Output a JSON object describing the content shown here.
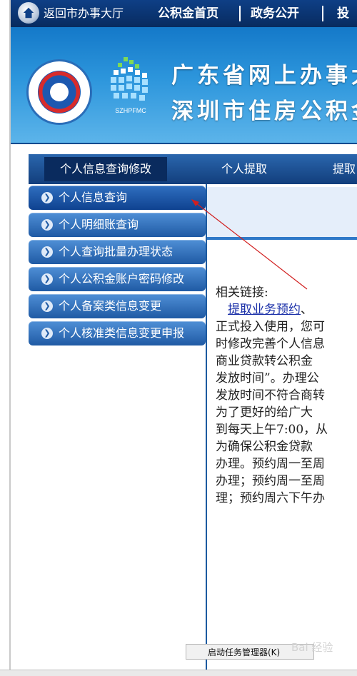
{
  "topnav": {
    "back_label": "返回市办事大厅",
    "items": [
      "公积金首页",
      "政务公开",
      "投"
    ]
  },
  "banner": {
    "line1": "广东省网上办事大",
    "line2": "深圳市住房公积金",
    "emblem_text": "SZHPFMC"
  },
  "tabs": [
    {
      "label": "个人信息查询修改",
      "active": true
    },
    {
      "label": "个人提取",
      "active": false
    },
    {
      "label": "提取",
      "active": false
    }
  ],
  "sidebar": {
    "items": [
      {
        "label": "个人信息查询",
        "icon": "arrow-right-icon"
      },
      {
        "label": "个人明细账查询",
        "icon": "arrow-right-icon"
      },
      {
        "label": "个人查询批量办理状态",
        "icon": "arrow-right-icon"
      },
      {
        "label": "个人公积金账户密码修改",
        "icon": "arrow-right-icon"
      },
      {
        "label": "个人备案类信息变更",
        "icon": "arrow-right-icon"
      },
      {
        "label": "个人核准类信息变更申报",
        "icon": "arrow-right-icon"
      }
    ]
  },
  "content": {
    "heading": "相关链接:",
    "link_text": "提取业务预约",
    "link_suffix": "、",
    "lines": [
      "正式投入使用，您可",
      "时修改完善个人信息",
      "  商业贷款转公积金",
      "发放时间”。办理公",
      "发放时间不符合商转",
      "  为了更好的给广大",
      "到每天上午7:00，从",
      "  为确保公积金贷款",
      "办理。预约周一至周",
      "办理；预约周一至周",
      "理；预约周六下午办"
    ]
  },
  "taskbar": {
    "tooltip": "启动任务管理器(K)",
    "watermark": "Bai 经验"
  },
  "colors": {
    "nav_dark": "#082b5f",
    "banner_blue": "#2d96dc",
    "sidebar_blue": "#1f5aa4",
    "link": "#1a2fa8",
    "annotation_arrow": "#d11f1f"
  }
}
